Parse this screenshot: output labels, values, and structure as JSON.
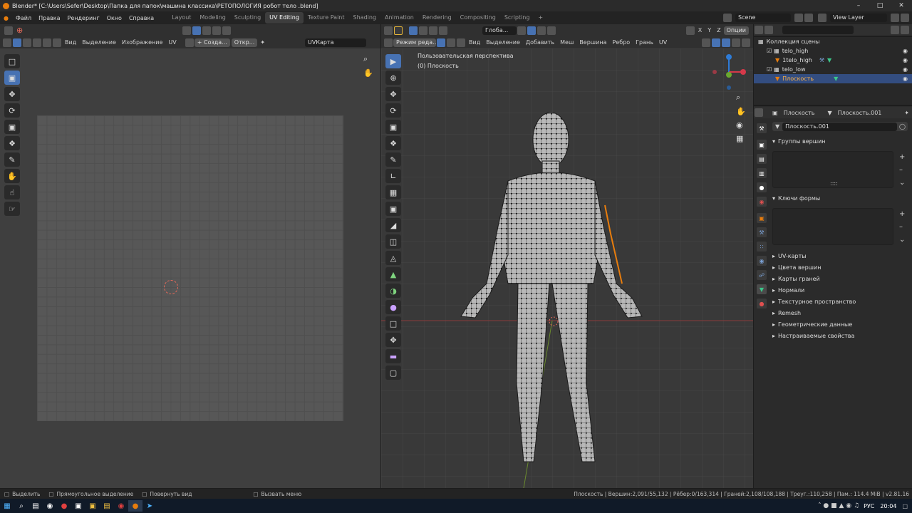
{
  "titlebar": {
    "title": "Blender* [C:\\Users\\Sefer\\Desktop\\Папка для папок\\машина классика\\РЕТОПОЛОГИЯ робот тело .blend]"
  },
  "menubar": {
    "menus": [
      "Файл",
      "Правка",
      "Рендеринг",
      "Окно",
      "Справка"
    ],
    "workspaces": [
      "Layout",
      "Modeling",
      "Sculpting",
      "UV Editing",
      "Texture Paint",
      "Shading",
      "Animation",
      "Rendering",
      "Compositing",
      "Scripting"
    ],
    "active_workspace": "UV Editing",
    "add_tab": "+",
    "scene_name": "Scene",
    "view_layer": "View Layer"
  },
  "uv_editor": {
    "menus": [
      "Вид",
      "Выделение",
      "Изображение",
      "UV"
    ],
    "new_button": "+ Созда...",
    "open_button": "Откр...",
    "uvmap_field": "UVКарта"
  },
  "viewport": {
    "mode": "Режим реда...",
    "menus": [
      "Вид",
      "Выделение",
      "Добавить",
      "Меш",
      "Вершина",
      "Ребро",
      "Грань",
      "UV"
    ],
    "transform_orientation": "Глоба...",
    "axes": [
      "X",
      "Y",
      "Z"
    ],
    "options": "Опции",
    "info_line1": "Пользовательская перспектива",
    "info_line2": "(0) Плоскость"
  },
  "outliner": {
    "search_placeholder": "",
    "items": [
      {
        "label": "Коллекция сцены"
      },
      {
        "label": "telo_high"
      },
      {
        "label": "1telo_high"
      },
      {
        "label": "telo_low"
      },
      {
        "label": "Плоскость"
      }
    ]
  },
  "properties": {
    "object_name": "Плоскость",
    "mesh_name": "Плоскость.001",
    "datablock": "Плоскость.001",
    "panels_open": [
      "Группы вершин",
      "Ключи формы"
    ],
    "panels": [
      "UV-карты",
      "Цвета вершин",
      "Карты граней",
      "Нормали",
      "Текстурное пространство",
      "Remesh",
      "Геометрические данные",
      "Настраиваемые свойства"
    ],
    "list_dots": "::::"
  },
  "status": {
    "select": "Выделить",
    "box_select": "Прямоугольное выделение",
    "rotate_view": "Повернуть вид",
    "call_menu": "Вызвать меню",
    "stats": "Плоскость | Вершин:2,091/55,132 | Рёбер:0/163,314 | Граней:2,108/108,188 | Треуг.:110,258 | Пам.: 114.4 MiB | v2.81.16"
  },
  "taskbar": {
    "lang": "РУС",
    "time": "20:04"
  },
  "colors": {
    "accent": "#4772b3",
    "selected_row": "#334d80",
    "orange": "#e87d0d"
  }
}
